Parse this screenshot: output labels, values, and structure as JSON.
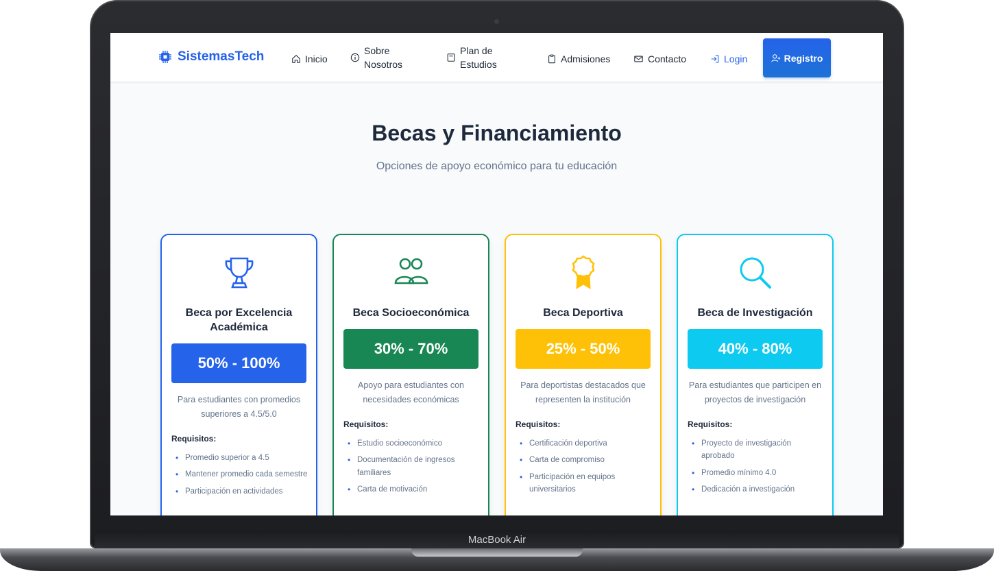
{
  "device": {
    "label": "MacBook Air"
  },
  "nav": {
    "brand": "SistemasTech",
    "inicio": "Inicio",
    "sobre_1": "Sobre",
    "sobre_2": "Nosotros",
    "plan_1": "Plan de",
    "plan_2": "Estudios",
    "admisiones": "Admisiones",
    "contacto": "Contacto",
    "login": "Login",
    "registro": "Registro"
  },
  "header": {
    "title": "Becas y Financiamiento",
    "subtitle": "Opciones de apoyo económico para tu educación"
  },
  "cards": [
    {
      "title": "Beca por Excelencia Académica",
      "range": "50% - 100%",
      "description": "Para estudiantes con promedios superiores a 4.5/5.0",
      "requirements_label": "Requisitos:",
      "requirements": [
        "Promedio superior a 4.5",
        "Mantener promedio cada semestre",
        "Participación en actividades"
      ],
      "color": "#2563eb",
      "icon": "trophy-icon"
    },
    {
      "title": "Beca Socioeconómica",
      "range": "30% - 70%",
      "description": "Apoyo para estudiantes con necesidades económicas",
      "requirements_label": "Requisitos:",
      "requirements": [
        "Estudio socioeconómico",
        "Documentación de ingresos familiares",
        "Carta de motivación"
      ],
      "color": "#198754",
      "icon": "people-icon"
    },
    {
      "title": "Beca Deportiva",
      "range": "25% - 50%",
      "description": "Para deportistas destacados que representen la institución",
      "requirements_label": "Requisitos:",
      "requirements": [
        "Certificación deportiva",
        "Carta de compromiso",
        "Participación en equipos universitarios"
      ],
      "color": "#ffc107",
      "icon": "award-icon"
    },
    {
      "title": "Beca de Investigación",
      "range": "40% - 80%",
      "description": "Para estudiantes que participen en proyectos de investigación",
      "requirements_label": "Requisitos:",
      "requirements": [
        "Proyecto de investigación aprobado",
        "Promedio mínimo 4.0",
        "Dedicación a investigación"
      ],
      "color": "#0dcaf0",
      "icon": "search-icon"
    }
  ]
}
